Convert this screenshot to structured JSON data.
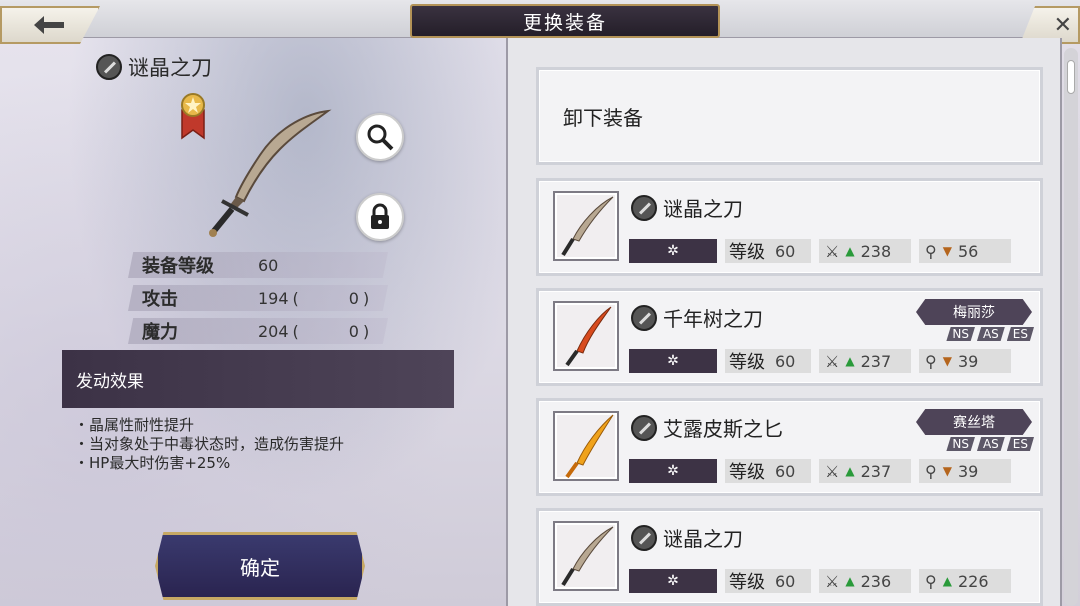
{
  "header": {
    "title": "更换装备"
  },
  "selected": {
    "name": "谜晶之刀",
    "stats": [
      {
        "label": "装备等级",
        "value": "60",
        "bonus": ""
      },
      {
        "label": "攻击",
        "value": "194",
        "bonus": "0"
      },
      {
        "label": "魔力",
        "value": "204",
        "bonus": "0"
      }
    ],
    "effect_title": "发动效果",
    "effects": [
      "・晶属性耐性提升",
      "・当对象处于中毒状态时，造成伤害提升",
      "・HP最大时伤害+25%"
    ],
    "confirm_label": "确定"
  },
  "list": {
    "unequip_label": "卸下装备",
    "items": [
      {
        "name": "谜晶之刀",
        "level_label": "等级",
        "level": "60",
        "atk": "238",
        "atk_trend": "up",
        "mag": "56",
        "mag_trend": "down",
        "character": "",
        "tags": []
      },
      {
        "name": "千年树之刀",
        "level_label": "等级",
        "level": "60",
        "atk": "237",
        "atk_trend": "up",
        "mag": "39",
        "mag_trend": "down",
        "character": "梅丽莎",
        "tags": [
          "NS",
          "AS",
          "ES"
        ]
      },
      {
        "name": "艾露皮斯之匕",
        "level_label": "等级",
        "level": "60",
        "atk": "237",
        "atk_trend": "up",
        "mag": "39",
        "mag_trend": "down",
        "character": "赛丝塔",
        "tags": [
          "NS",
          "AS",
          "ES"
        ]
      },
      {
        "name": "谜晶之刀",
        "level_label": "等级",
        "level": "60",
        "atk": "236",
        "atk_trend": "up",
        "mag": "226",
        "mag_trend": "up",
        "character": "",
        "tags": []
      }
    ]
  },
  "colors": {
    "accent_gold": "#b39357",
    "panel_dark": "#3c3246",
    "up_green": "#2a9a3a",
    "down_orange": "#b5651d"
  }
}
